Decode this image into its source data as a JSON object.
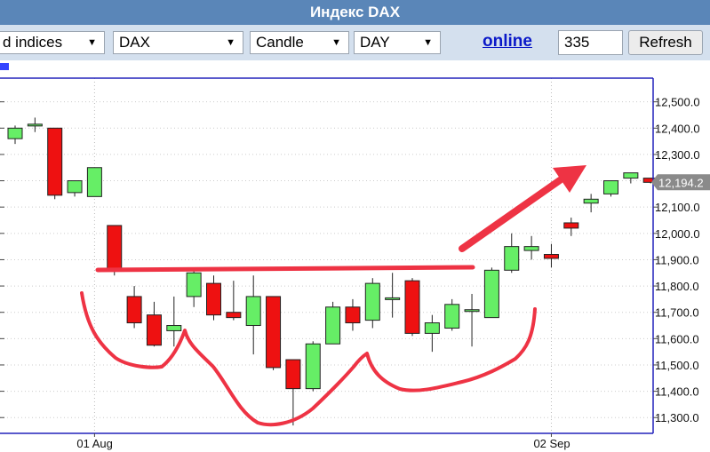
{
  "window": {
    "title": "Индекс DAX"
  },
  "toolbar": {
    "market_select": "d indices",
    "symbol_select": "DAX",
    "chart_type_select": "Candle",
    "period_select": "DAY",
    "online_link": "online",
    "count_value": "335",
    "refresh_label": "Refresh"
  },
  "colors": {
    "up": "#66ee66",
    "down": "#ee1111",
    "annotation": "#ee3344",
    "frame": "#2222bb"
  },
  "chart_data": {
    "type": "candlestick",
    "yticks": [
      11300,
      11400,
      11500,
      11600,
      11700,
      11800,
      11900,
      12000,
      12100,
      12200,
      12300,
      12400,
      12500
    ],
    "ytick_labels": [
      "11,300.0",
      "11,400.0",
      "11,500.0",
      "11,600.0",
      "11,700.0",
      "11,800.0",
      "11,900.0",
      "12,000.0",
      "12,100.0",
      "12,200.0",
      "12,300.0",
      "12,400.0",
      "12,500.0"
    ],
    "ylim": [
      11240,
      12590
    ],
    "xtick_labels": [
      {
        "label": "01 Aug",
        "index": 4
      },
      {
        "label": "02 Sep",
        "index": 27
      }
    ],
    "last_price_label": "12,194.2",
    "last_price": 12194.2,
    "candles": [
      {
        "open": 12360,
        "high": 12410,
        "low": 12340,
        "close": 12400
      },
      {
        "open": 12415,
        "high": 12440,
        "low": 12385,
        "close": 12415
      },
      {
        "open": 12400,
        "high": 12400,
        "low": 12130,
        "close": 12145
      },
      {
        "open": 12155,
        "high": 12200,
        "low": 12140,
        "close": 12200
      },
      {
        "open": 12140,
        "high": 12250,
        "low": 12140,
        "close": 12250
      },
      {
        "open": 12030,
        "high": 12030,
        "low": 11840,
        "close": 11865
      },
      {
        "open": 11760,
        "high": 11800,
        "low": 11640,
        "close": 11660
      },
      {
        "open": 11690,
        "high": 11740,
        "low": 11570,
        "close": 11575
      },
      {
        "open": 11630,
        "high": 11760,
        "low": 11570,
        "close": 11650
      },
      {
        "open": 11760,
        "high": 11870,
        "low": 11720,
        "close": 11850
      },
      {
        "open": 11810,
        "high": 11840,
        "low": 11670,
        "close": 11690
      },
      {
        "open": 11700,
        "high": 11820,
        "low": 11670,
        "close": 11680
      },
      {
        "open": 11650,
        "high": 11840,
        "low": 11540,
        "close": 11760
      },
      {
        "open": 11760,
        "high": 11760,
        "low": 11480,
        "close": 11490
      },
      {
        "open": 11520,
        "high": 11520,
        "low": 11270,
        "close": 11410
      },
      {
        "open": 11410,
        "high": 11590,
        "low": 11400,
        "close": 11580
      },
      {
        "open": 11580,
        "high": 11740,
        "low": 11580,
        "close": 11720
      },
      {
        "open": 11720,
        "high": 11750,
        "low": 11630,
        "close": 11660
      },
      {
        "open": 11670,
        "high": 11830,
        "low": 11640,
        "close": 11810
      },
      {
        "open": 11750,
        "high": 11850,
        "low": 11680,
        "close": 11755
      },
      {
        "open": 11820,
        "high": 11830,
        "low": 11610,
        "close": 11620
      },
      {
        "open": 11620,
        "high": 11690,
        "low": 11550,
        "close": 11660
      },
      {
        "open": 11640,
        "high": 11750,
        "low": 11630,
        "close": 11730
      },
      {
        "open": 11710,
        "high": 11770,
        "low": 11570,
        "close": 11710
      },
      {
        "open": 11680,
        "high": 11870,
        "low": 11680,
        "close": 11860
      },
      {
        "open": 11860,
        "high": 12000,
        "low": 11850,
        "close": 11950
      },
      {
        "open": 11935,
        "high": 11990,
        "low": 11900,
        "close": 11950
      },
      {
        "open": 11920,
        "high": 11960,
        "low": 11870,
        "close": 11905
      },
      {
        "open": 12040,
        "high": 12060,
        "low": 11990,
        "close": 12020
      },
      {
        "open": 12115,
        "high": 12150,
        "low": 12080,
        "close": 12130
      },
      {
        "open": 12150,
        "high": 12200,
        "low": 12140,
        "close": 12200
      },
      {
        "open": 12210,
        "high": 12230,
        "low": 12190,
        "close": 12230
      },
      {
        "open": 12210,
        "high": 12210,
        "low": 12190,
        "close": 12194
      }
    ]
  }
}
